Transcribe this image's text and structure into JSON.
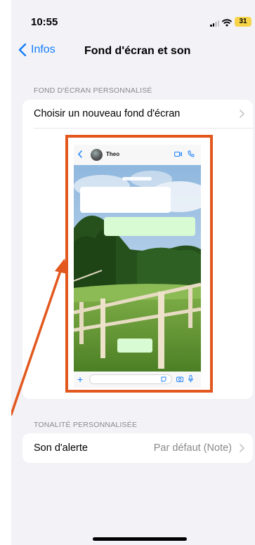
{
  "status_bar": {
    "time": "10:55",
    "battery": "31"
  },
  "nav": {
    "back_label": "Infos",
    "title": "Fond d'écran et son"
  },
  "wallpaper_section": {
    "header": "FOND D'ÉCRAN PERSONNALISÉ",
    "choose_label": "Choisir un nouveau fond d'écran"
  },
  "preview": {
    "contact_name": "Theo"
  },
  "tone_section": {
    "header": "TONALITÉ PERSONNALISÉE",
    "alert_label": "Son d'alerte",
    "alert_value": "Par défaut (Note)"
  },
  "colors": {
    "accent": "#147efb",
    "highlight": "#e2581e",
    "background": "#f2f2f7"
  }
}
